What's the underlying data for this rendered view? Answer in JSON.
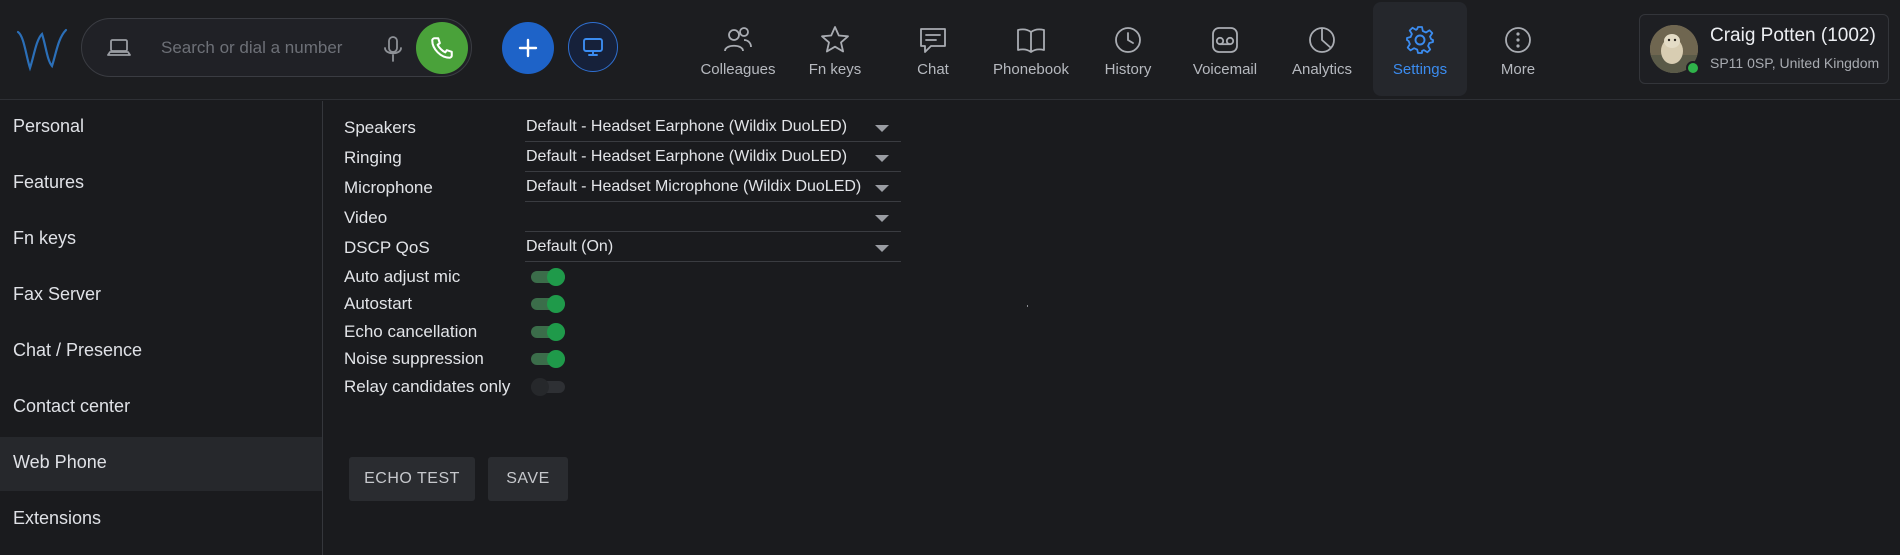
{
  "header": {
    "search": {
      "placeholder": "Search or dial a number",
      "value": ""
    },
    "nav": [
      {
        "label": "Colleagues",
        "icon": "colleagues-icon"
      },
      {
        "label": "Fn keys",
        "icon": "star-icon"
      },
      {
        "label": "Chat",
        "icon": "chat-icon"
      },
      {
        "label": "Phonebook",
        "icon": "book-icon"
      },
      {
        "label": "History",
        "icon": "clock-icon"
      },
      {
        "label": "Voicemail",
        "icon": "voicemail-icon"
      },
      {
        "label": "Analytics",
        "icon": "pie-chart-icon"
      },
      {
        "label": "Settings",
        "icon": "gear-icon",
        "active": true
      },
      {
        "label": "More",
        "icon": "more-icon"
      }
    ],
    "profile": {
      "name": "Craig Potten (1002)",
      "location": "SP11 0SP, United Kingdom",
      "status": "online"
    }
  },
  "sidebar": {
    "items": [
      {
        "label": "Personal"
      },
      {
        "label": "Features"
      },
      {
        "label": "Fn keys"
      },
      {
        "label": "Fax Server"
      },
      {
        "label": "Chat / Presence"
      },
      {
        "label": "Contact center"
      },
      {
        "label": "Web Phone",
        "active": true
      },
      {
        "label": "Extensions"
      }
    ]
  },
  "webphone": {
    "selects": [
      {
        "label": "Speakers",
        "value": "Default - Headset Earphone (Wildix DuoLED)"
      },
      {
        "label": "Ringing",
        "value": "Default - Headset Earphone (Wildix DuoLED)"
      },
      {
        "label": "Microphone",
        "value": "Default - Headset Microphone (Wildix DuoLED)"
      },
      {
        "label": "Video",
        "value": ""
      },
      {
        "label": "DSCP QoS",
        "value": "Default (On)"
      }
    ],
    "toggles": [
      {
        "label": "Auto adjust mic",
        "on": true
      },
      {
        "label": "Autostart",
        "on": true
      },
      {
        "label": "Echo cancellation",
        "on": true
      },
      {
        "label": "Noise suppression",
        "on": true
      },
      {
        "label": "Relay candidates only",
        "on": false
      }
    ],
    "buttons": {
      "echo_test": "ECHO TEST",
      "save": "SAVE"
    }
  },
  "colors": {
    "accent": "#3b8cf0",
    "call_green": "#4aa23a",
    "add_blue": "#1e63c8",
    "toggle_on": "#1f9a4a"
  }
}
